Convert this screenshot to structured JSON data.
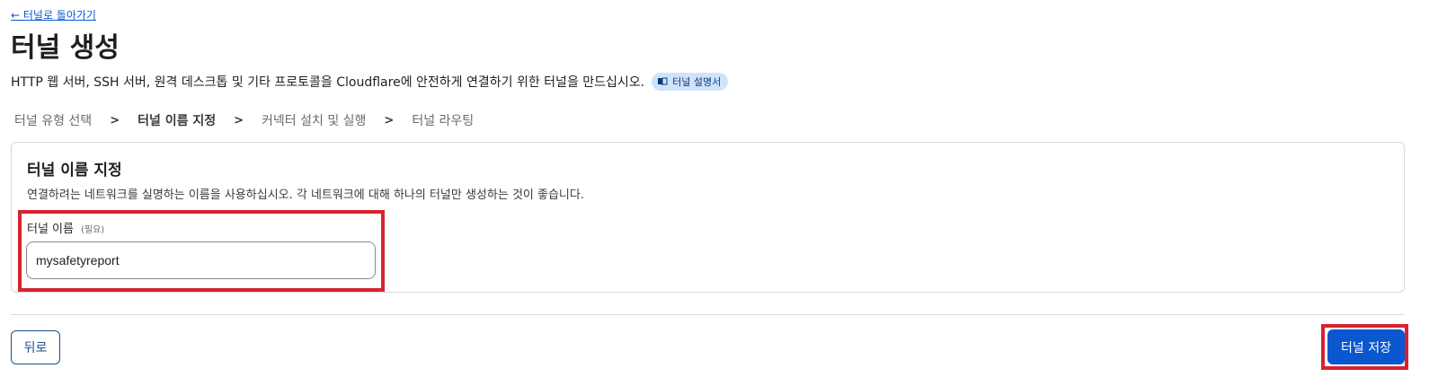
{
  "header": {
    "back_link": "← 터널로 돌아가기",
    "title": "터널 생성",
    "description": "HTTP 웹 서버, SSH 서버, 원격 데스크톱 및 기타 프로토콜을 Cloudflare에 안전하게 연결하기 위한 터널을 만드십시오.",
    "doc_badge": "터널 설명서",
    "doc_badge_icon": "book-icon"
  },
  "steps": {
    "items": [
      "터널 유형 선택",
      "터널 이름 지정",
      "커넥터 설치 및 실행",
      "터널 라우팅"
    ],
    "separator": ">",
    "current_index": 1
  },
  "form": {
    "card_title": "터널 이름 지정",
    "card_description": "연결하려는 네트워크를 실명하는 이름을 사용하십시오. 각 네트워크에 대해 하나의 터널만 생성하는 것이 좋습니다.",
    "field_label": "터널 이름",
    "field_required": "(필요)",
    "field_value": "mysafetyreport"
  },
  "footer": {
    "back_label": "뒤로",
    "save_label": "터널 저장"
  },
  "colors": {
    "primary": "#0b57d0",
    "highlight": "#d6232f",
    "badge_bg": "#cfe3fb"
  }
}
